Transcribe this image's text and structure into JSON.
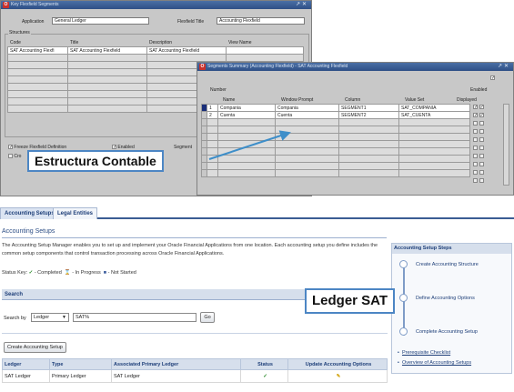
{
  "window1": {
    "title": "Key Flexfield Segments",
    "controls": "↗✕",
    "application_label": "Application",
    "application_value": "General Ledger",
    "flexfield_title_label": "Flexfield Title",
    "flexfield_title_value": "Accounting Flexfield",
    "structures_label": "Structures",
    "headers": {
      "code": "Code",
      "title": "Title",
      "description": "Description",
      "view_name": "View Name"
    },
    "first_row": {
      "code": "SAT Accounting Flexfi",
      "title": "SAT Accounting Flexfield",
      "description": "SAT Accounting Flexfield",
      "view_name": ""
    },
    "freeze_label": "Freeze Flexfield Definition",
    "enabled_label": "Enabled",
    "segment_separator_label": "Segment",
    "cross_validate_label": "Cro"
  },
  "window2": {
    "title": "Segments Summary (Accounting Flexfield) - SAT Accounting Flexfield",
    "controls": "↗✕",
    "enabled_label": "Enabled",
    "number_label": "Number",
    "headers": {
      "name": "Name",
      "window_prompt": "Window Prompt",
      "column": "Column",
      "value_set": "Value Set",
      "displayed": "Displayed"
    },
    "rows": [
      {
        "number": "1",
        "name": "Compania",
        "window_prompt": "Compania",
        "column": "SEGMENT1",
        "value_set": "SAT_COMPANIA"
      },
      {
        "number": "2",
        "name": "Cuenta",
        "window_prompt": "Cuenta",
        "column": "SEGMENT2",
        "value_set": "SAT_CUENTA"
      }
    ]
  },
  "callouts": {
    "estructura": "Estructura Contable",
    "ledger": "Ledger SAT"
  },
  "oaf": {
    "tabs": [
      "Accounting Setups",
      "Legal Entities"
    ],
    "page_title": "Accounting Setups",
    "intro": "The Accounting Setup Manager enables you to set up and implement your Oracle Financial Applications from one location. Each accounting setup you define includes the common setup components that control transaction processing across Oracle Financial Applications.",
    "status_key": {
      "label": "Status Key:",
      "completed_icon": "✓",
      "completed": "- Completed",
      "in_progress_icon": "⌛",
      "in_progress": "- In Progress",
      "not_started_icon": "■",
      "not_started": "- Not Started"
    },
    "search": {
      "header": "Search",
      "search_by_label": "Search by",
      "search_by_value": "Ledger",
      "query": "SAT%",
      "go_label": "Go"
    },
    "create_button": "Create Accounting Setup",
    "table": {
      "headers": [
        "Ledger",
        "Type",
        "Associated Primary Ledger",
        "Status",
        "Update Accounting Options"
      ],
      "rows": [
        {
          "ledger": "SAT Ledger",
          "type": "Primary Ledger",
          "associated": "SAT Ledger",
          "status_icon": "✓",
          "update_icon": "✎"
        }
      ]
    },
    "steps": {
      "header": "Accounting Setup Steps",
      "items": [
        "Create Accounting Structure",
        "Define Accounting Options",
        "Complete Accounting Setup"
      ],
      "links": [
        "Prerequisite Checklist",
        "Overview of Accounting Setups"
      ]
    }
  }
}
